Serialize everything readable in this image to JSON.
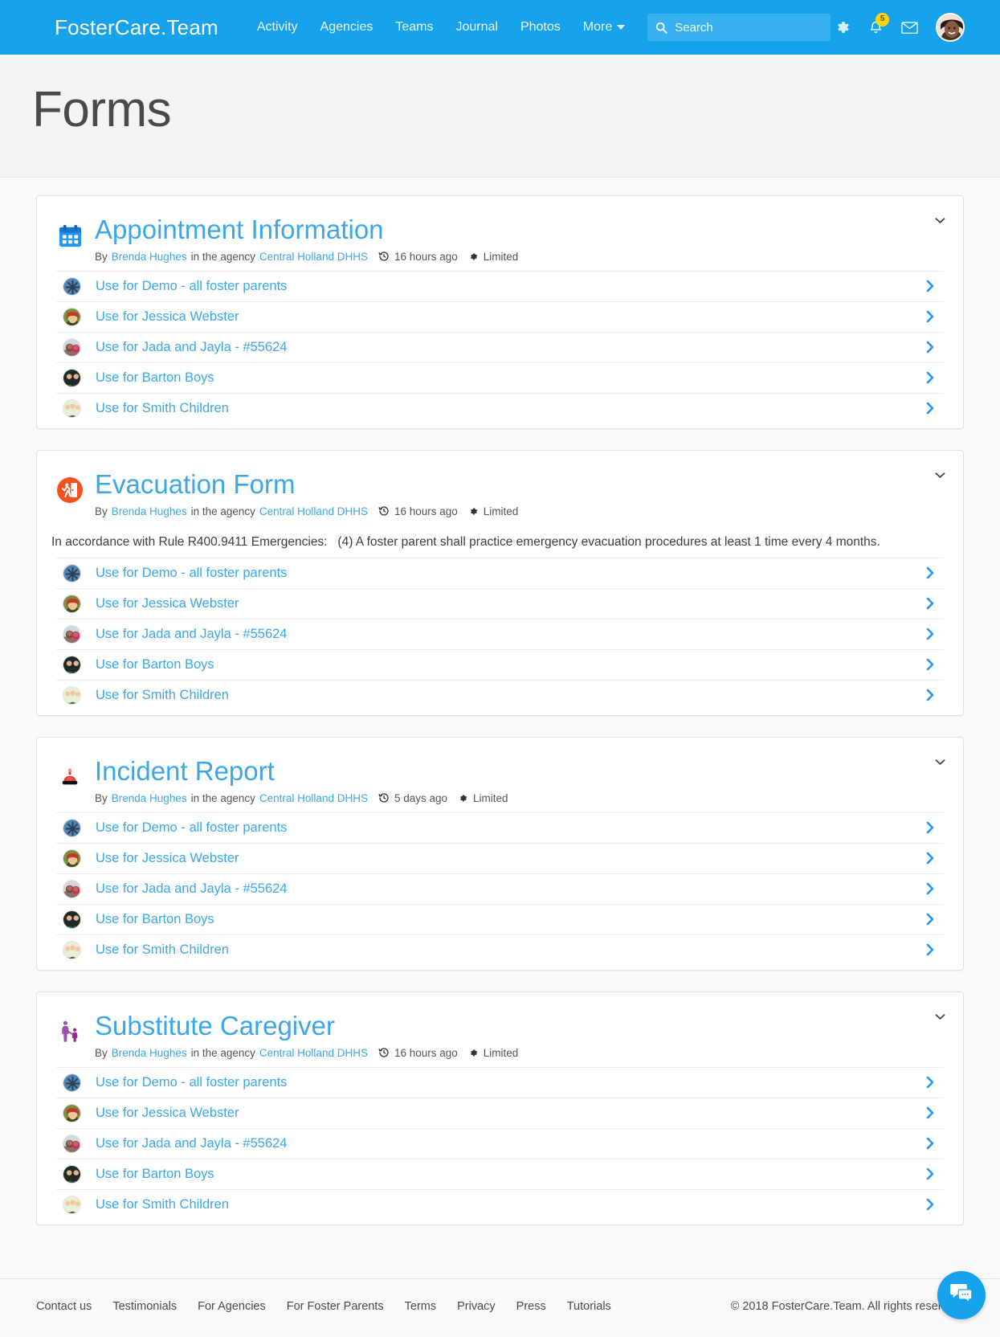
{
  "nav": {
    "brand": "FosterCare.Team",
    "links": [
      {
        "label": "Activity",
        "name": "nav-activity"
      },
      {
        "label": "Agencies",
        "name": "nav-agencies"
      },
      {
        "label": "Teams",
        "name": "nav-teams"
      },
      {
        "label": "Journal",
        "name": "nav-journal"
      },
      {
        "label": "Photos",
        "name": "nav-photos"
      },
      {
        "label": "More",
        "name": "nav-more",
        "has_caret": true
      }
    ],
    "search": {
      "placeholder": "Search",
      "value": "",
      "icon": "search-icon"
    },
    "icons": {
      "settings": "gear-icon",
      "notifications": "bell-icon",
      "messages": "envelope-icon",
      "avatar": "user-avatar"
    },
    "notification_count": "5",
    "accent_color": "#17a3ec",
    "badge_color": "#ffd40d"
  },
  "page": {
    "title": "Forms"
  },
  "forms": [
    {
      "title": "Appointment Information",
      "icon": "calendar-icon",
      "by_label": "By",
      "author": "Brenda Hughes",
      "agency_label": "in the agency",
      "agency": "Central Holland DHHS",
      "time_icon": "history-icon",
      "time": "16 hours ago",
      "visibility_icon": "gear-icon",
      "visibility": "Limited",
      "description": "",
      "uses": [
        {
          "label": "Use for Demo - all foster parents",
          "avatar": "avatar-demo"
        },
        {
          "label": "Use for Jessica Webster",
          "avatar": "avatar-jessica"
        },
        {
          "label": "Use for Jada and Jayla - #55624",
          "avatar": "avatar-jada-jayla"
        },
        {
          "label": "Use for Barton Boys",
          "avatar": "avatar-barton"
        },
        {
          "label": "Use for Smith Children",
          "avatar": "avatar-smith"
        }
      ]
    },
    {
      "title": "Evacuation Form",
      "icon": "evacuation-icon",
      "by_label": "By",
      "author": "Brenda Hughes",
      "agency_label": "in the agency",
      "agency": "Central Holland DHHS",
      "time_icon": "history-icon",
      "time": "16 hours ago",
      "visibility_icon": "gear-icon",
      "visibility": "Limited",
      "description": "In accordance with Rule R400.9411 Emergencies:   (4) A foster parent shall practice emergency evacuation procedures at least 1 time every 4 months.",
      "uses": [
        {
          "label": "Use for Demo - all foster parents",
          "avatar": "avatar-demo"
        },
        {
          "label": "Use for Jessica Webster",
          "avatar": "avatar-jessica"
        },
        {
          "label": "Use for Jada and Jayla - #55624",
          "avatar": "avatar-jada-jayla"
        },
        {
          "label": "Use for Barton Boys",
          "avatar": "avatar-barton"
        },
        {
          "label": "Use for Smith Children",
          "avatar": "avatar-smith"
        }
      ]
    },
    {
      "title": "Incident Report",
      "icon": "siren-icon",
      "by_label": "By",
      "author": "Brenda Hughes",
      "agency_label": "in the agency",
      "agency": "Central Holland DHHS",
      "time_icon": "history-icon",
      "time": "5 days ago",
      "visibility_icon": "gear-icon",
      "visibility": "Limited",
      "description": "",
      "uses": [
        {
          "label": "Use for Demo - all foster parents",
          "avatar": "avatar-demo"
        },
        {
          "label": "Use for Jessica Webster",
          "avatar": "avatar-jessica"
        },
        {
          "label": "Use for Jada and Jayla - #55624",
          "avatar": "avatar-jada-jayla"
        },
        {
          "label": "Use for Barton Boys",
          "avatar": "avatar-barton"
        },
        {
          "label": "Use for Smith Children",
          "avatar": "avatar-smith"
        }
      ]
    },
    {
      "title": "Substitute Caregiver",
      "icon": "caregiver-icon",
      "by_label": "By",
      "author": "Brenda Hughes",
      "agency_label": "in the agency",
      "agency": "Central Holland DHHS",
      "time_icon": "history-icon",
      "time": "16 hours ago",
      "visibility_icon": "gear-icon",
      "visibility": "Limited",
      "description": "",
      "uses": [
        {
          "label": "Use for Demo - all foster parents",
          "avatar": "avatar-demo"
        },
        {
          "label": "Use for Jessica Webster",
          "avatar": "avatar-jessica"
        },
        {
          "label": "Use for Jada and Jayla - #55624",
          "avatar": "avatar-jada-jayla"
        },
        {
          "label": "Use for Barton Boys",
          "avatar": "avatar-barton"
        },
        {
          "label": "Use for Smith Children",
          "avatar": "avatar-smith"
        }
      ]
    }
  ],
  "footer": {
    "links": [
      "Contact us",
      "Testimonials",
      "For Agencies",
      "For Foster Parents",
      "Terms",
      "Privacy",
      "Press",
      "Tutorials"
    ],
    "copyright": "© 2018 FosterCare.Team. All rights reserved.",
    "chat_icon": "chat-icon"
  }
}
